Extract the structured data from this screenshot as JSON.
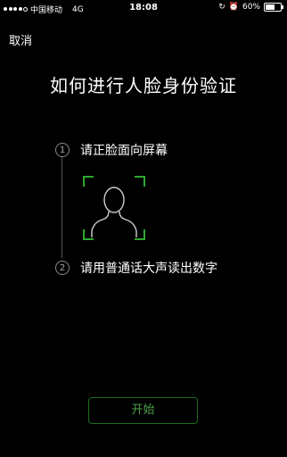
{
  "status_bar": {
    "carrier": "中国移动",
    "network": "4G",
    "time": "18:08",
    "battery": "60%"
  },
  "header": {
    "cancel_label": "取消"
  },
  "main": {
    "title": "如何进行人脸身份验证",
    "steps": [
      {
        "number": "1",
        "text": "请正脸面向屏幕"
      },
      {
        "number": "2",
        "text": "请用普通话大声读出数字"
      }
    ],
    "start_label": "开始"
  },
  "colors": {
    "background": "#000000",
    "accent_green": "#2fa82f"
  }
}
